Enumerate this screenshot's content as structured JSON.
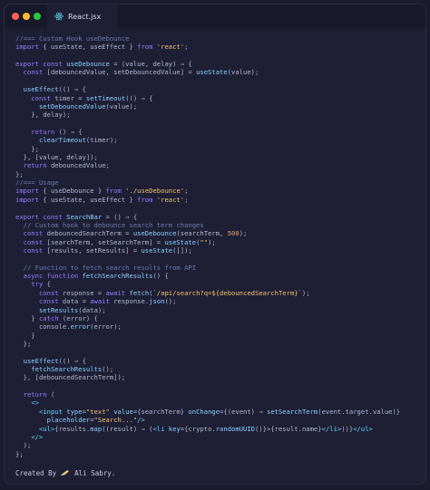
{
  "window": {
    "tab_label": "React.jsx"
  },
  "code_lines": [
    [
      {
        "t": "comment",
        "v": "//=== Custom Hook useDebounce"
      }
    ],
    [
      {
        "t": "kw",
        "v": "import"
      },
      {
        "t": "punct",
        "v": " { useState, useEffect } "
      },
      {
        "t": "kw",
        "v": "from"
      },
      {
        "t": "str",
        "v": " 'react'"
      },
      {
        "t": "punct",
        "v": ";"
      }
    ],
    [
      {
        "t": "punct",
        "v": ""
      }
    ],
    [
      {
        "t": "kw",
        "v": "export const"
      },
      {
        "t": "fn",
        "v": " useDebounce"
      },
      {
        "t": "punct",
        "v": " = (value, delay) ⇒ {"
      }
    ],
    [
      {
        "t": "kw",
        "v": "  const"
      },
      {
        "t": "punct",
        "v": " [debouncedValue, setDebouncedValue] = "
      },
      {
        "t": "fn",
        "v": "useState"
      },
      {
        "t": "punct",
        "v": "(value);"
      }
    ],
    [
      {
        "t": "punct",
        "v": ""
      }
    ],
    [
      {
        "t": "fn",
        "v": "  useEffect"
      },
      {
        "t": "punct",
        "v": "(() ⇒ {"
      }
    ],
    [
      {
        "t": "kw",
        "v": "    const"
      },
      {
        "t": "punct",
        "v": " timer = "
      },
      {
        "t": "fn",
        "v": "setTimeout"
      },
      {
        "t": "punct",
        "v": "(() ⇒ {"
      }
    ],
    [
      {
        "t": "fn",
        "v": "      setDebouncedValue"
      },
      {
        "t": "punct",
        "v": "(value);"
      }
    ],
    [
      {
        "t": "punct",
        "v": "    }, delay);"
      }
    ],
    [
      {
        "t": "punct",
        "v": ""
      }
    ],
    [
      {
        "t": "kw",
        "v": "    return"
      },
      {
        "t": "punct",
        "v": " () ⇒ {"
      }
    ],
    [
      {
        "t": "fn",
        "v": "      clearTimeout"
      },
      {
        "t": "punct",
        "v": "(timer);"
      }
    ],
    [
      {
        "t": "punct",
        "v": "    };"
      }
    ],
    [
      {
        "t": "punct",
        "v": "  }, [value, delay]);"
      }
    ],
    [
      {
        "t": "kw",
        "v": "  return"
      },
      {
        "t": "punct",
        "v": " debouncedValue;"
      }
    ],
    [
      {
        "t": "punct",
        "v": "};"
      }
    ],
    [
      {
        "t": "comment",
        "v": "//=== Usage"
      }
    ],
    [
      {
        "t": "kw",
        "v": "import"
      },
      {
        "t": "punct",
        "v": " { useDebounce } "
      },
      {
        "t": "kw",
        "v": "from"
      },
      {
        "t": "str",
        "v": " './useDebounce'"
      },
      {
        "t": "punct",
        "v": ";"
      }
    ],
    [
      {
        "t": "kw",
        "v": "import"
      },
      {
        "t": "punct",
        "v": " { useState, useEffect } "
      },
      {
        "t": "kw",
        "v": "from"
      },
      {
        "t": "str",
        "v": " 'react'"
      },
      {
        "t": "punct",
        "v": ";"
      }
    ],
    [
      {
        "t": "punct",
        "v": ""
      }
    ],
    [
      {
        "t": "kw",
        "v": "export const"
      },
      {
        "t": "fn",
        "v": " SearchBar"
      },
      {
        "t": "punct",
        "v": " = () ⇒ {"
      }
    ],
    [
      {
        "t": "comment",
        "v": "  // Custom hook to debounce search term changes"
      }
    ],
    [
      {
        "t": "kw",
        "v": "  const"
      },
      {
        "t": "punct",
        "v": " debouncedSearchTerm = "
      },
      {
        "t": "fn",
        "v": "useDebounce"
      },
      {
        "t": "punct",
        "v": "(searchTerm, "
      },
      {
        "t": "num",
        "v": "500"
      },
      {
        "t": "punct",
        "v": ");"
      }
    ],
    [
      {
        "t": "kw",
        "v": "  const"
      },
      {
        "t": "punct",
        "v": " [searchTerm, setSearchTerm] = "
      },
      {
        "t": "fn",
        "v": "useState"
      },
      {
        "t": "punct",
        "v": "("
      },
      {
        "t": "str",
        "v": "\"\""
      },
      {
        "t": "punct",
        "v": ");"
      }
    ],
    [
      {
        "t": "kw",
        "v": "  const"
      },
      {
        "t": "punct",
        "v": " [results, setResults] = "
      },
      {
        "t": "fn",
        "v": "useState"
      },
      {
        "t": "punct",
        "v": "([]);"
      }
    ],
    [
      {
        "t": "punct",
        "v": ""
      }
    ],
    [
      {
        "t": "comment",
        "v": "  // Function to fetch search results from API"
      }
    ],
    [
      {
        "t": "kw",
        "v": "  async function"
      },
      {
        "t": "fn",
        "v": " fetchSearchResults"
      },
      {
        "t": "punct",
        "v": "() {"
      }
    ],
    [
      {
        "t": "kw",
        "v": "    try"
      },
      {
        "t": "punct",
        "v": " {"
      }
    ],
    [
      {
        "t": "kw",
        "v": "      const"
      },
      {
        "t": "punct",
        "v": " response = "
      },
      {
        "t": "kw",
        "v": "await"
      },
      {
        "t": "fn",
        "v": " fetch"
      },
      {
        "t": "punct",
        "v": "("
      },
      {
        "t": "str",
        "v": "`/api/search?q=${debouncedSearchTerm}`"
      },
      {
        "t": "punct",
        "v": ");"
      }
    ],
    [
      {
        "t": "kw",
        "v": "      const"
      },
      {
        "t": "punct",
        "v": " data = "
      },
      {
        "t": "kw",
        "v": "await"
      },
      {
        "t": "punct",
        "v": " response."
      },
      {
        "t": "fn",
        "v": "json"
      },
      {
        "t": "punct",
        "v": "();"
      }
    ],
    [
      {
        "t": "fn",
        "v": "      setResults"
      },
      {
        "t": "punct",
        "v": "(data);"
      }
    ],
    [
      {
        "t": "punct",
        "v": "    } "
      },
      {
        "t": "kw",
        "v": "catch"
      },
      {
        "t": "punct",
        "v": " (error) {"
      }
    ],
    [
      {
        "t": "punct",
        "v": "      console."
      },
      {
        "t": "fn",
        "v": "error"
      },
      {
        "t": "punct",
        "v": "(error);"
      }
    ],
    [
      {
        "t": "punct",
        "v": "    }"
      }
    ],
    [
      {
        "t": "punct",
        "v": "  };"
      }
    ],
    [
      {
        "t": "punct",
        "v": ""
      }
    ],
    [
      {
        "t": "fn",
        "v": "  useEffect"
      },
      {
        "t": "punct",
        "v": "(() ⇒ {"
      }
    ],
    [
      {
        "t": "fn",
        "v": "    fetchSearchResults"
      },
      {
        "t": "punct",
        "v": "();"
      }
    ],
    [
      {
        "t": "punct",
        "v": "  }, [debouncedSearchTerm]);"
      }
    ],
    [
      {
        "t": "punct",
        "v": ""
      }
    ],
    [
      {
        "t": "kw",
        "v": "  return"
      },
      {
        "t": "punct",
        "v": " ("
      }
    ],
    [
      {
        "t": "jsx",
        "v": "    <>"
      }
    ],
    [
      {
        "t": "jsx",
        "v": "      <input"
      },
      {
        "t": "fn",
        "v": " type"
      },
      {
        "t": "punct",
        "v": "="
      },
      {
        "t": "str",
        "v": "\"text\""
      },
      {
        "t": "fn",
        "v": " value"
      },
      {
        "t": "punct",
        "v": "={searchTerm}"
      },
      {
        "t": "fn",
        "v": " onChange"
      },
      {
        "t": "punct",
        "v": "={(event) ⇒ "
      },
      {
        "t": "fn",
        "v": "setSearchTerm"
      },
      {
        "t": "punct",
        "v": "(event.target.value)}"
      }
    ],
    [
      {
        "t": "fn",
        "v": "        placeholder"
      },
      {
        "t": "punct",
        "v": "="
      },
      {
        "t": "str",
        "v": "\"Search...\""
      },
      {
        "t": "jsx",
        "v": "/>"
      }
    ],
    [
      {
        "t": "jsx",
        "v": "      <ul>"
      },
      {
        "t": "punct",
        "v": "{results."
      },
      {
        "t": "fn",
        "v": "map"
      },
      {
        "t": "punct",
        "v": "((result) ⇒ ("
      },
      {
        "t": "jsx",
        "v": "<li"
      },
      {
        "t": "fn",
        "v": " key"
      },
      {
        "t": "punct",
        "v": "={crypto."
      },
      {
        "t": "fn",
        "v": "randomUUID"
      },
      {
        "t": "punct",
        "v": "()}>{result.name}"
      },
      {
        "t": "jsx",
        "v": "</li>"
      },
      {
        "t": "punct",
        "v": "))}"
      },
      {
        "t": "jsx",
        "v": "</ul>"
      }
    ],
    [
      {
        "t": "jsx",
        "v": "    </>"
      }
    ],
    [
      {
        "t": "punct",
        "v": "  );"
      }
    ],
    [
      {
        "t": "punct",
        "v": "};"
      }
    ]
  ],
  "footer": {
    "created_by": "Created By",
    "author": "Ali Sabry."
  }
}
